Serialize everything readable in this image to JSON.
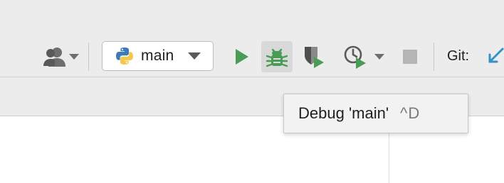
{
  "toolbar": {
    "run_config": {
      "name": "main",
      "icon": "python-icon"
    },
    "git_label": "Git:",
    "icons": {
      "user": "user-icon",
      "run": "run-icon",
      "debug": "debug-bug-icon",
      "coverage": "coverage-icon",
      "profile": "profile-icon",
      "stop": "stop-icon",
      "update": "git-update-icon"
    }
  },
  "tooltip": {
    "text": "Debug 'main'",
    "shortcut": "^D"
  },
  "colors": {
    "run_green": "#499C54",
    "toolbar_bg": "#ECECEC",
    "git_blue": "#3592C4",
    "stop_gray": "#B5B5B5"
  }
}
